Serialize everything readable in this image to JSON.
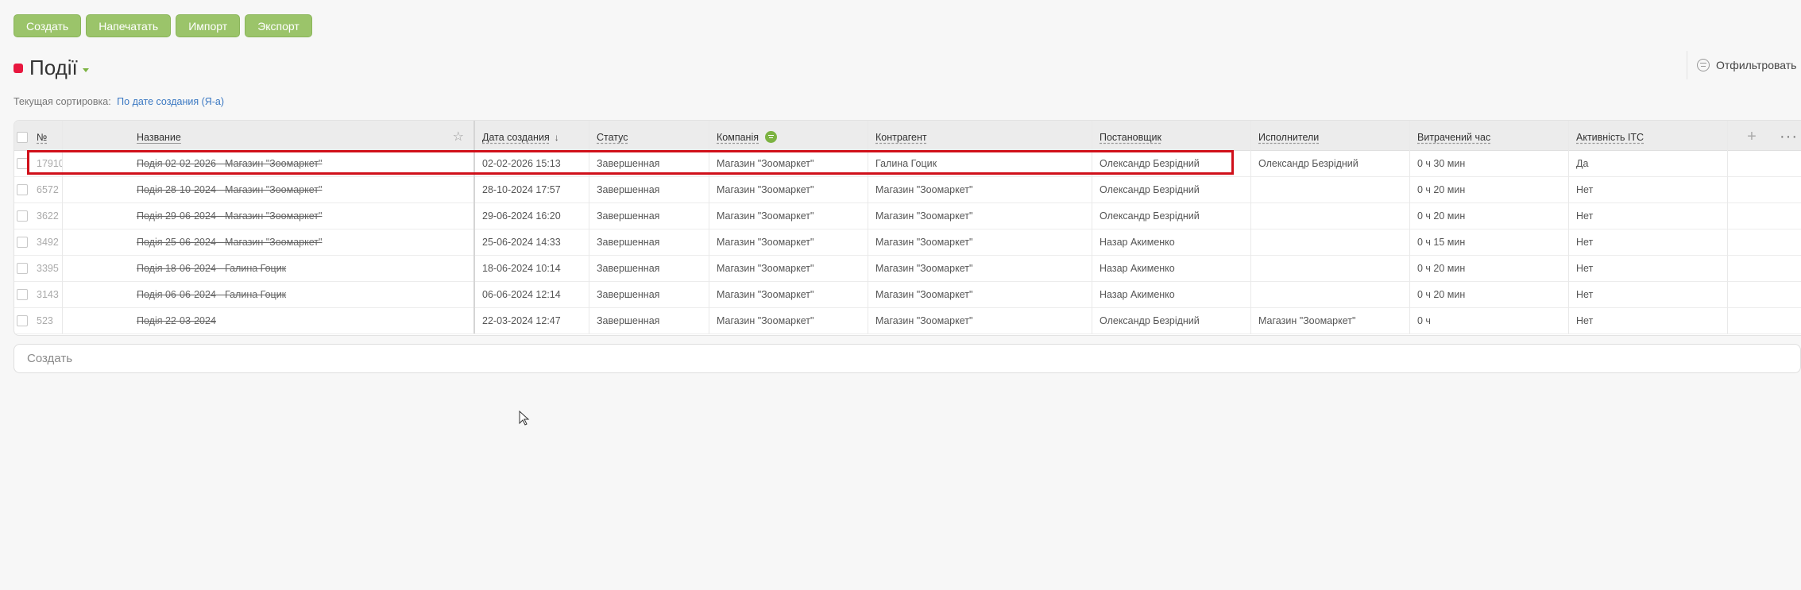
{
  "toolbar": {
    "create": "Создать",
    "print": "Напечатать",
    "import": "Импорт",
    "export": "Экспорт"
  },
  "page": {
    "title": "Події",
    "filter_label": "Отфильтровать",
    "sorting_label": "Текущая сортировка:",
    "sorting_value": "По дате создания (Я-а)"
  },
  "table": {
    "columns": {
      "num": "№",
      "name": "Название",
      "created": "Дата создания",
      "status": "Статус",
      "company": "Компанія",
      "contractor": "Контрагент",
      "author": "Постановщик",
      "executors": "Исполнители",
      "time_spent": "Витрачений час",
      "activity": "Активність ІТС"
    },
    "rows": [
      {
        "num": "17910",
        "name": "Подія 02-02-2026 - Магазин \"Зоомаркет\"",
        "created": "02-02-2026 15:13",
        "status": "Завершенная",
        "company": "Магазин \"Зоомаркет\"",
        "contractor": "Галина Гоцик",
        "author": "Олександр Безрідний",
        "executors": "Олександр Безрідний",
        "time_spent": "0 ч 30 мин",
        "activity": "Да"
      },
      {
        "num": "6572",
        "name": "Подія 28-10-2024 - Магазин \"Зоомаркет\"",
        "created": "28-10-2024 17:57",
        "status": "Завершенная",
        "company": "Магазин \"Зоомаркет\"",
        "contractor": "Магазин \"Зоомаркет\"",
        "author": "Олександр Безрідний",
        "executors": "",
        "time_spent": "0 ч 20 мин",
        "activity": "Нет"
      },
      {
        "num": "3622",
        "name": "Подія 29-06-2024 - Магазин \"Зоомаркет\"",
        "created": "29-06-2024 16:20",
        "status": "Завершенная",
        "company": "Магазин \"Зоомаркет\"",
        "contractor": "Магазин \"Зоомаркет\"",
        "author": "Олександр Безрідний",
        "executors": "",
        "time_spent": "0 ч 20 мин",
        "activity": "Нет"
      },
      {
        "num": "3492",
        "name": "Подія 25-06-2024 - Магазин \"Зоомаркет\"",
        "created": "25-06-2024 14:33",
        "status": "Завершенная",
        "company": "Магазин \"Зоомаркет\"",
        "contractor": "Магазин \"Зоомаркет\"",
        "author": "Назар Акименко",
        "executors": "",
        "time_spent": "0 ч 15 мин",
        "activity": "Нет"
      },
      {
        "num": "3395",
        "name": "Подія 18-06-2024 - Галина Гоцик",
        "created": "18-06-2024 10:14",
        "status": "Завершенная",
        "company": "Магазин \"Зоомаркет\"",
        "contractor": "Магазин \"Зоомаркет\"",
        "author": "Назар Акименко",
        "executors": "",
        "time_spent": "0 ч 20 мин",
        "activity": "Нет"
      },
      {
        "num": "3143",
        "name": "Подія 06-06-2024 - Галина Гоцик",
        "created": "06-06-2024 12:14",
        "status": "Завершенная",
        "company": "Магазин \"Зоомаркет\"",
        "contractor": "Магазин \"Зоомаркет\"",
        "author": "Назар Акименко",
        "executors": "",
        "time_spent": "0 ч 20 мин",
        "activity": "Нет"
      },
      {
        "num": "523",
        "name": "Подія 22-03-2024",
        "created": "22-03-2024 12:47",
        "status": "Завершенная",
        "company": "Магазин \"Зоомаркет\"",
        "contractor": "Магазин \"Зоомаркет\"",
        "author": "Олександр Безрідний",
        "executors": "Магазин \"Зоомаркет\"",
        "time_spent": "0 ч",
        "activity": "Нет"
      }
    ]
  },
  "footer": {
    "create_placeholder": "Создать"
  },
  "icons": {
    "title_dot": "status-dot-icon",
    "star": "star-icon",
    "sort": "sort-arrow-down-icon",
    "filter": "filter-icon",
    "plus": "plus-icon",
    "more": "more-dots-icon"
  },
  "colors": {
    "accent": "#9bc46a",
    "title_dot": "#e8173f",
    "link": "#3b78c2",
    "highlight": "#d0101a"
  }
}
